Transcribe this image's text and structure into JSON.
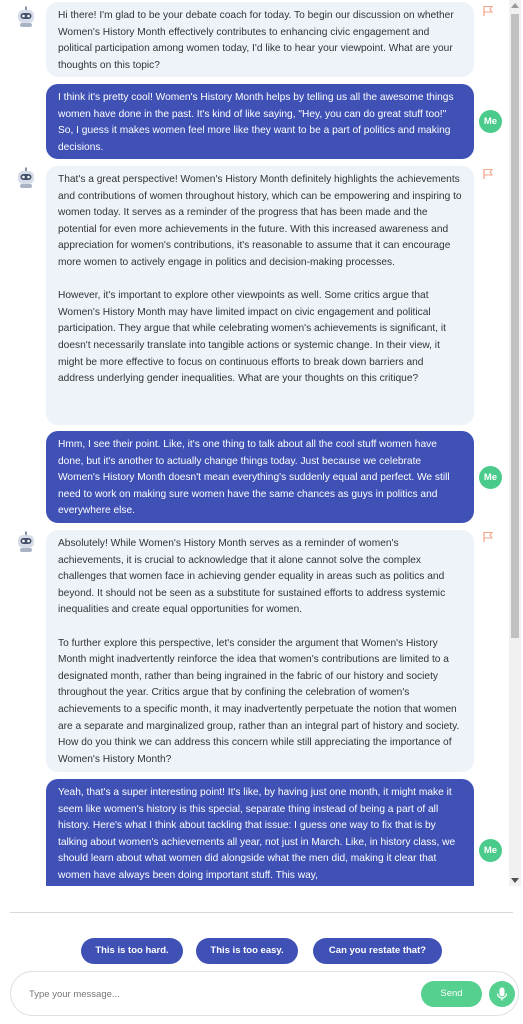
{
  "messages": [
    {
      "role": "bot",
      "paragraphs": [
        "Hi there! I'm glad to be your debate coach for today. To begin our discussion on whether Women's History Month effectively contributes to enhancing civic engagement and political participation among women today, I'd like to hear your viewpoint. What are your thoughts on this topic?"
      ]
    },
    {
      "role": "user",
      "avatar_label": "Me",
      "paragraphs": [
        "I think it's pretty cool! Women's History Month helps by telling us all the awesome things women have done in the past. It's kind of like saying, \"Hey, you can do great stuff too!\" So, I guess it makes women feel more like they want to be a part of politics and making decisions."
      ]
    },
    {
      "role": "bot",
      "paragraphs": [
        "That's a great perspective! Women's History Month definitely highlights the achievements and contributions of women throughout history, which can be empowering and inspiring to women today. It serves as a reminder of the progress that has been made and the potential for even more achievements in the future. With this increased awareness and appreciation for women's contributions, it's reasonable to assume that it can encourage more women to actively engage in politics and decision-making processes.",
        "However, it's important to explore other viewpoints as well. Some critics argue that Women's History Month may have limited impact on civic engagement and political participation. They argue that while celebrating women's achievements is significant, it doesn't necessarily translate into tangible actions or systemic change. In their view, it might be more effective to focus on continuous efforts to break down barriers and address underlying gender inequalities. What are your thoughts on this critique?"
      ]
    },
    {
      "role": "user",
      "avatar_label": "Me",
      "paragraphs": [
        "Hmm, I see their point. Like, it's one thing to talk about all the cool stuff women have done, but it's another to actually change things today. Just because we celebrate Women's History Month doesn't mean everything's suddenly equal and perfect. We still need to work on making sure women have the same chances as guys in politics and everywhere else."
      ]
    },
    {
      "role": "bot",
      "paragraphs": [
        "Absolutely! While Women's History Month serves as a reminder of women's achievements, it is crucial to acknowledge that it alone cannot solve the complex challenges that women face in achieving gender equality in areas such as politics and beyond. It should not be seen as a substitute for sustained efforts to address systemic inequalities and create equal opportunities for women.",
        "To further explore this perspective, let's consider the argument that Women's History Month might inadvertently reinforce the idea that women's contributions are limited to a designated month, rather than being ingrained in the fabric of our history and society throughout the year. Critics argue that by confining the celebration of women's achievements to a specific month, it may inadvertently perpetuate the notion that women are a separate and marginalized group, rather than an integral part of history and society. How do you think we can address this concern while still appreciating the importance of Women's History Month?"
      ]
    },
    {
      "role": "user",
      "avatar_label": "Me",
      "paragraphs": [
        "Yeah, that's a super interesting point! It's like, by having just one month, it might make it seem like women's history is this special, separate thing instead of being a part of all history. Here's what I think about tackling that issue: I guess one way to fix that is by talking about women's achievements all year, not just in March. Like, in history class, we should learn about what women did alongside what the men did, making it clear that women have always been doing important stuff. This way,"
      ]
    }
  ],
  "quick_replies": [
    "This is too hard.",
    "This is too easy.",
    "Can you restate that?"
  ],
  "composer": {
    "placeholder": "Type your message...",
    "value": "",
    "send_label": "Send"
  },
  "icons": {
    "bot_avatar": "robot-avatar-icon",
    "report": "flag-icon",
    "mic": "microphone-icon"
  },
  "colors": {
    "user_bubble": "#3f51b5",
    "bot_bubble": "#eef3fa",
    "accent_green": "#56d08f",
    "flag": "#f4a58a"
  }
}
